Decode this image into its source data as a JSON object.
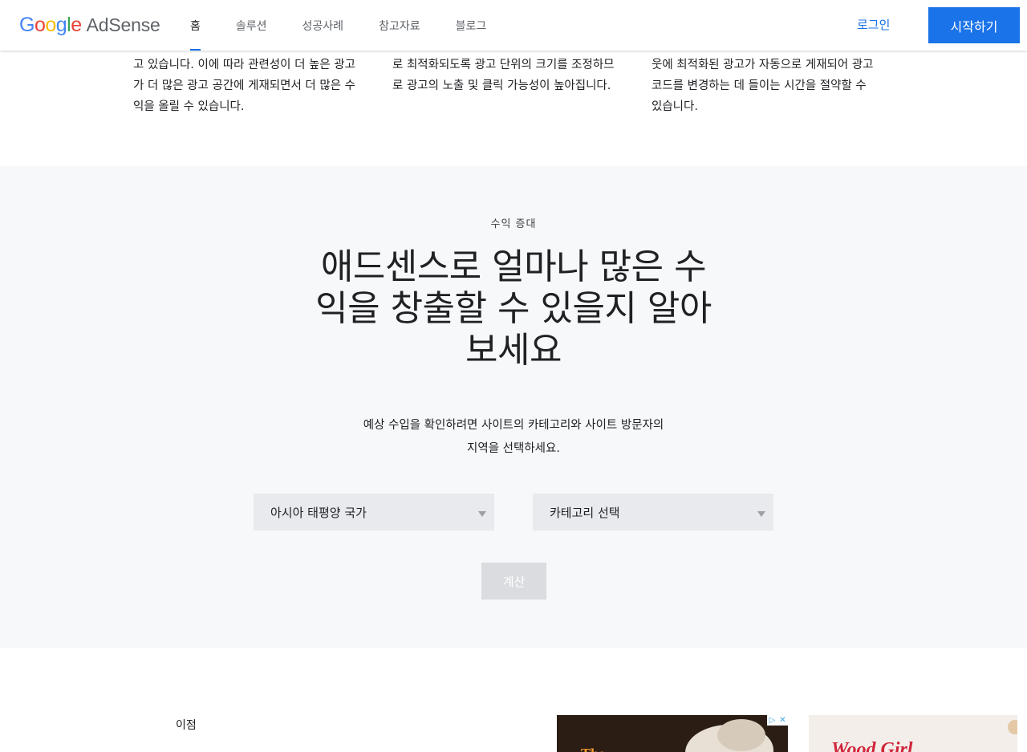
{
  "header": {
    "logo_google": "Google",
    "logo_product": "AdSense",
    "nav": [
      {
        "label": "홈",
        "active": true
      },
      {
        "label": "솔루션",
        "active": false
      },
      {
        "label": "성공사례",
        "active": false
      },
      {
        "label": "참고자료",
        "active": false
      },
      {
        "label": "블로그",
        "active": false
      }
    ],
    "login_label": "로그인",
    "start_label": "시작하기"
  },
  "columns": {
    "col1": [
      "고 있습니다. 이에 따라 관련성이 더 높은 광고",
      "가 더 많은 광고 공간에 게재되면서 더 많은 수",
      "익을 올릴 수 있습니다."
    ],
    "col2": [
      "로 최적화되도록 광고 단위의 크기를 조정하므",
      "로 광고의 노출 및 클릭 가능성이 높아집니다."
    ],
    "col3": [
      "웃에 최적화된 광고가 자동으로 게재되어 광고",
      "코드를 변경하는 데 들이는 시간을 절약할 수",
      "있습니다."
    ]
  },
  "revenue": {
    "eyebrow": "수익 증대",
    "headline": [
      "애드센스로 얼마나 많은 수",
      "익을 창출할 수 있을지 알아",
      "보세요"
    ],
    "description": [
      "예상 수입을 확인하려면 사이트의 카테고리와 사이트 방문자의",
      "지역을 선택하세요."
    ],
    "region_select": "아시아 태평양 국가",
    "category_select": "카테고리 선택",
    "calc_label": "계산"
  },
  "benefits": {
    "label": "이점",
    "card1_text": "The",
    "card2_text": "Wood Girl"
  },
  "colors": {
    "accent": "#1a73e8",
    "section_bg": "#f7f8fa",
    "select_bg": "#e8eaed",
    "disabled_btn": "#dadce0"
  }
}
